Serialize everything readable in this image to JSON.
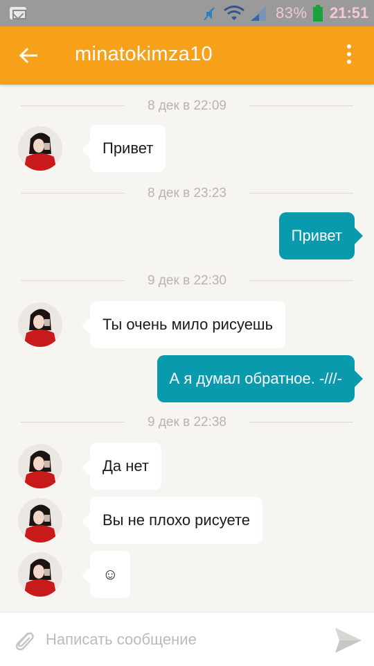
{
  "status_bar": {
    "battery_percent": "83%",
    "time": "21:51",
    "icons": [
      "notification-icon",
      "mute-icon",
      "wifi-icon",
      "signal-icon",
      "battery-icon"
    ]
  },
  "app_bar": {
    "title": "minatokimza10",
    "color": "#f7a01a",
    "icons": [
      "back-arrow-icon",
      "more-vert-icon"
    ]
  },
  "thread": {
    "dates": [
      "8 дек в 22:09",
      "8 дек в 23:23",
      "9 дек в 22:30",
      "9 дек в 22:38"
    ],
    "messages": [
      {
        "from": "them",
        "text": "Привет"
      },
      {
        "from": "me",
        "text": "Привет"
      },
      {
        "from": "them",
        "text": "Ты очень мило рисуешь"
      },
      {
        "from": "me",
        "text": "А я думал обратное. -///-"
      },
      {
        "from": "them",
        "text": "Да нет"
      },
      {
        "from": "them",
        "text": "Вы не плохо рисуете"
      },
      {
        "from": "them",
        "text": "☺"
      }
    ],
    "incoming_color": "#ffffff",
    "outgoing_color": "#0a9aae"
  },
  "composer": {
    "placeholder": "Написать сообщение",
    "value": "",
    "icons": [
      "attach-icon",
      "send-icon"
    ]
  }
}
